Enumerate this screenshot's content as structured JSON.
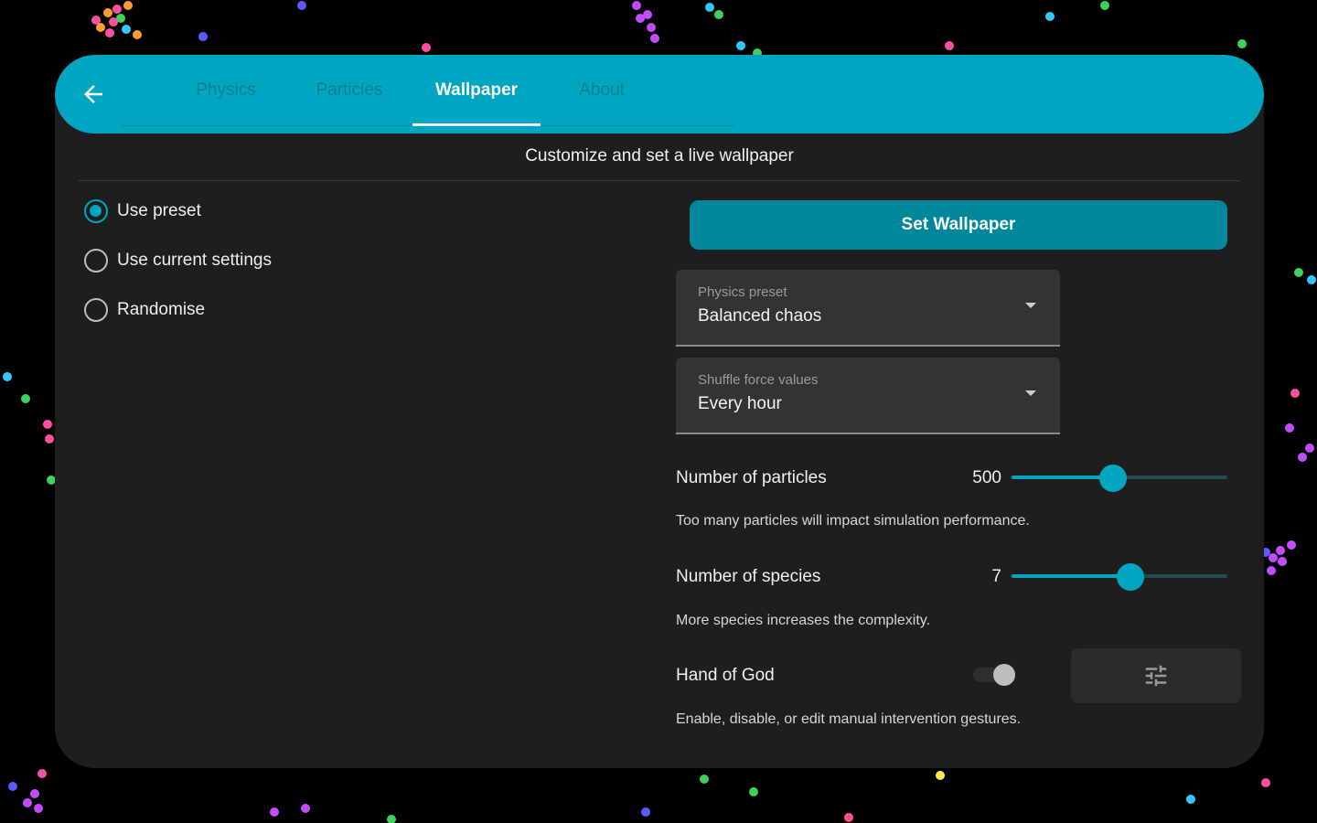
{
  "colors": {
    "accent": "#00a5c1",
    "button": "#00879b",
    "panel": "#1e1e1e",
    "background": "#000000"
  },
  "header": {
    "back_icon": "arrow-left-icon",
    "tabs": [
      {
        "label": "Physics",
        "active": false
      },
      {
        "label": "Particles",
        "active": false
      },
      {
        "label": "Wallpaper",
        "active": true
      },
      {
        "label": "About",
        "active": false
      }
    ]
  },
  "subtitle": "Customize and set a live wallpaper",
  "source_options": {
    "selected": 0,
    "items": [
      {
        "label": "Use preset"
      },
      {
        "label": "Use current settings"
      },
      {
        "label": "Randomise"
      }
    ]
  },
  "set_wallpaper_label": "Set Wallpaper",
  "physics_preset": {
    "label": "Physics preset",
    "value": "Balanced chaos"
  },
  "shuffle_force": {
    "label": "Shuffle force values",
    "value": "Every hour"
  },
  "particles": {
    "label": "Number of particles",
    "value": "500",
    "fraction": 0.47,
    "helper": "Too many particles will impact simulation performance."
  },
  "species": {
    "label": "Number of species",
    "value": "7",
    "fraction": 0.55,
    "helper": "More species increases the complexity."
  },
  "hand_of_god": {
    "label": "Hand of God",
    "enabled": false,
    "helper": "Enable, disable, or edit manual intervention gestures.",
    "edit_icon": "tune-sliders-icon"
  },
  "particle_colors": [
    "#ff4fa0",
    "#ff9d2e",
    "#5b5bff",
    "#3fd15a",
    "#34c8ff",
    "#c44bff",
    "#ffe94a"
  ]
}
